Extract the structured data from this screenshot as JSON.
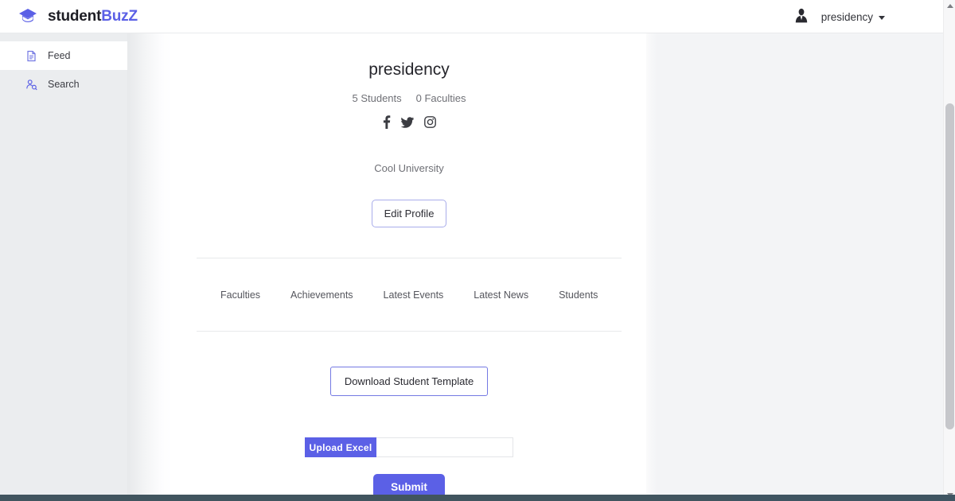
{
  "brand": {
    "name_part1": "student",
    "name_part2": "BuzZ",
    "logo_icon": "graduation-cap-icon",
    "accent_color": "#5b60e6"
  },
  "topbar": {
    "avatar_icon": "user-avatar-icon",
    "user_name": "presidency",
    "caret_icon": "chevron-down-icon"
  },
  "sidebar": {
    "items": [
      {
        "label": "Feed",
        "icon": "document-icon",
        "active": true
      },
      {
        "label": "Search",
        "icon": "person-search-icon",
        "active": false
      }
    ]
  },
  "profile": {
    "title": "presidency",
    "students_stat": "5 Students",
    "faculties_stat": "0 Faculties",
    "socials": [
      {
        "name": "facebook-icon",
        "label": "Facebook"
      },
      {
        "name": "twitter-icon",
        "label": "Twitter"
      },
      {
        "name": "instagram-icon",
        "label": "Instagram"
      }
    ],
    "organization": "Cool University",
    "edit_label": "Edit Profile"
  },
  "tabs": [
    {
      "label": "Faculties"
    },
    {
      "label": "Achievements"
    },
    {
      "label": "Latest Events"
    },
    {
      "label": "Latest News"
    },
    {
      "label": "Students"
    }
  ],
  "upload_section": {
    "download_template_label": "Download Student Template",
    "upload_button_label": "Upload Excel",
    "file_field_value": "",
    "file_field_placeholder": "",
    "submit_label": "Submit"
  },
  "colors": {
    "primary": "#5b60e6",
    "sidebar_bg": "#ebedef",
    "page_bg": "#f3f4f6",
    "footer_bar": "#3f5562"
  }
}
